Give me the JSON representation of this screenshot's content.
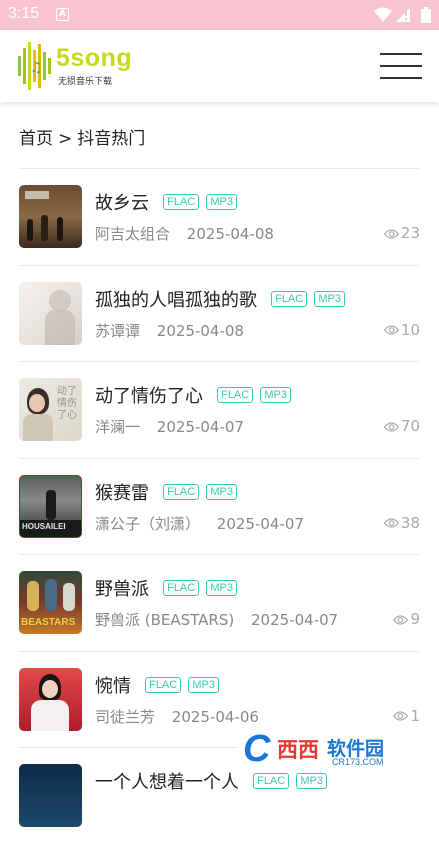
{
  "status_bar": {
    "time": "3:15",
    "app_icon": "A"
  },
  "header": {
    "logo_brand": "5song",
    "logo_tagline": "无损音乐下载",
    "menu_icon": "hamburger-menu-icon"
  },
  "breadcrumb": {
    "home": "首页",
    "separator": ">",
    "current": "抖音热门"
  },
  "songs": [
    {
      "title": "故乡云",
      "tags": [
        "FLAC",
        "MP3"
      ],
      "artist": "阿吉太组合",
      "date": "2025-04-08",
      "views": "23"
    },
    {
      "title": "孤独的人唱孤独的歌",
      "tags": [
        "FLAC",
        "MP3"
      ],
      "artist": "苏谭谭",
      "date": "2025-04-08",
      "views": "10"
    },
    {
      "title": "动了情伤了心",
      "tags": [
        "FLAC",
        "MP3"
      ],
      "artist": "洋澜一",
      "date": "2025-04-07",
      "views": "70"
    },
    {
      "title": "猴赛雷",
      "tags": [
        "FLAC",
        "MP3"
      ],
      "artist": "潇公子（刘潇）",
      "date": "2025-04-07",
      "views": "38"
    },
    {
      "title": "野兽派",
      "tags": [
        "FLAC",
        "MP3"
      ],
      "artist": "野兽派 (BEASTARS)",
      "date": "2025-04-07",
      "views": "9"
    },
    {
      "title": "惋情",
      "tags": [
        "FLAC",
        "MP3"
      ],
      "artist": "司徒兰芳",
      "date": "2025-04-06",
      "views": "1"
    },
    {
      "title": "一个人想着一个人",
      "tags": [
        "FLAC",
        "MP3"
      ],
      "artist": "",
      "date": "",
      "views": ""
    }
  ],
  "watermark": {
    "c": "C",
    "xixi": "西西",
    "rj": "软件园",
    "url": "CR173.COM"
  },
  "colors": {
    "status_bar": "#f7c4cf",
    "tag": "#3cc9b4",
    "logo": "#c8d81a"
  }
}
